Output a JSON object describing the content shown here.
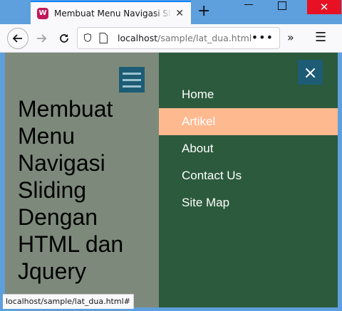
{
  "browser": {
    "tab_title": "Membuat Menu Navigasi Sliding Dengan HTML dan Jquery",
    "favicon_letter": "W",
    "new_tab_glyph": "+",
    "url_host": "localhost",
    "url_path": "/sample/lat_dua.html",
    "status_url": "localhost/sample/lat_dua.html#"
  },
  "page": {
    "heading": "Membuat Menu Navigasi Sliding Dengan HTML dan Jquery",
    "close_glyph": "×",
    "nav": [
      {
        "label": "Home",
        "active": false
      },
      {
        "label": "Artikel",
        "active": true
      },
      {
        "label": "About",
        "active": false
      },
      {
        "label": "Contact Us",
        "active": false
      },
      {
        "label": "Site Map",
        "active": false
      }
    ]
  },
  "colors": {
    "sidenav_bg": "#2b5a3c",
    "active_bg": "#ffb98f",
    "button_bg": "#1d5c74",
    "page_overlay": "#7d8a7b"
  }
}
